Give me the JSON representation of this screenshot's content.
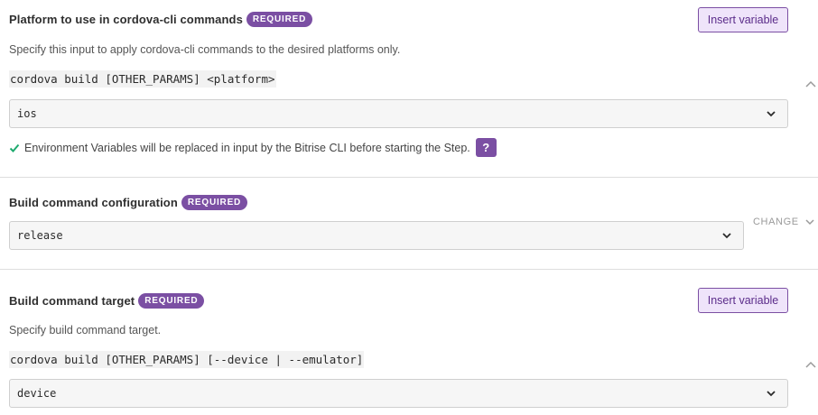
{
  "platform_section": {
    "title": "Platform to use in cordova-cli commands",
    "badge": "REQUIRED",
    "insert_label": "Insert variable",
    "description": "Specify this input to apply cordova-cli commands to the desired platforms only.",
    "code": "cordova build [OTHER_PARAMS] <platform>",
    "selected_value": "ios",
    "env_note": "Environment Variables will be replaced in input by the Bitrise CLI before starting the Step.",
    "help_label": "?"
  },
  "config_section": {
    "title": "Build command configuration",
    "badge": "REQUIRED",
    "selected_value": "release",
    "change_label": "CHANGE"
  },
  "target_section": {
    "title": "Build command target",
    "badge": "REQUIRED",
    "insert_label": "Insert variable",
    "description": "Specify build command target.",
    "code": "cordova build [OTHER_PARAMS] [--device | --emulator]",
    "selected_value": "device"
  },
  "colors": {
    "accent": "#7b4fa3",
    "insert_bg": "#efe4fa",
    "check": "#1eaa6e"
  },
  "icons": {
    "chevron_down": "chevron-down-icon",
    "chevron_up": "chevron-up-icon",
    "check": "check-icon"
  }
}
